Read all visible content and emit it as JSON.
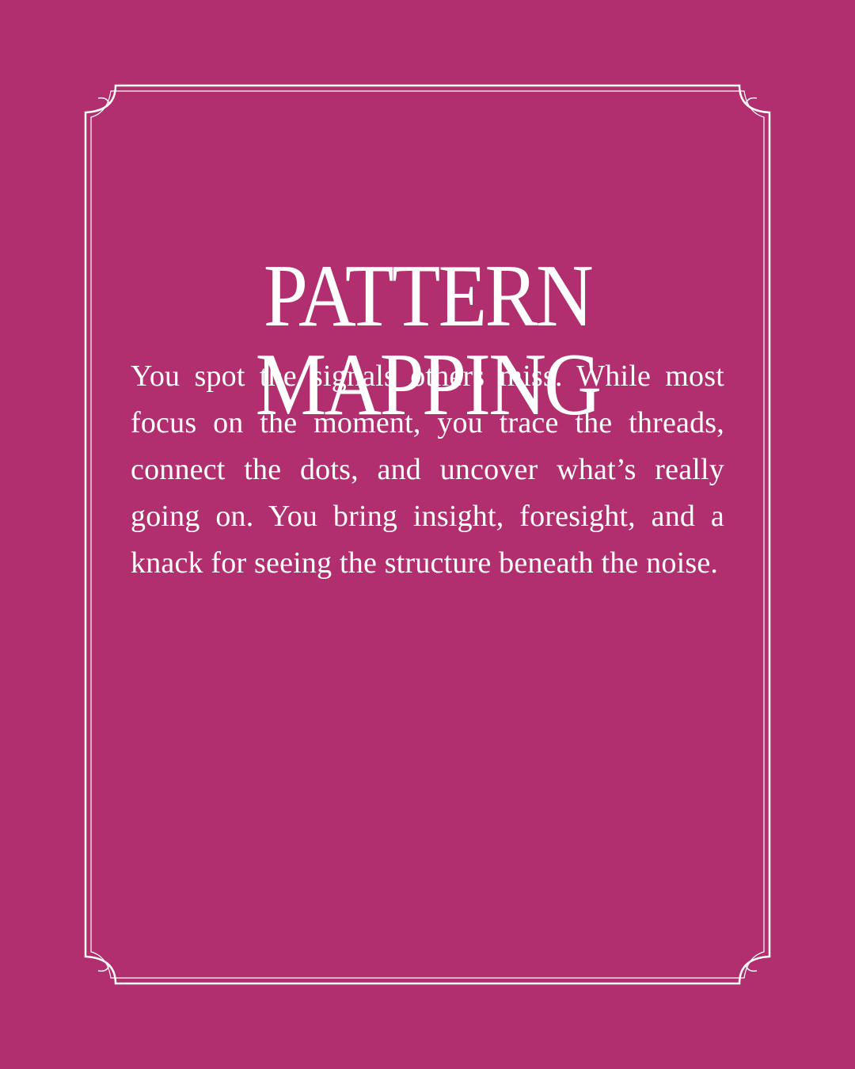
{
  "card": {
    "title": "PATTERN MAPPING",
    "description": "You spot the signals others miss. While most focus on the moment, you trace the threads, connect the dots, and uncover what’s really going on. You bring insight, foresight, and a knack for seeing the structure beneath the noise."
  },
  "colors": {
    "background": "#b12f6e",
    "text": "#ffffff",
    "frame": "#ffffff"
  }
}
